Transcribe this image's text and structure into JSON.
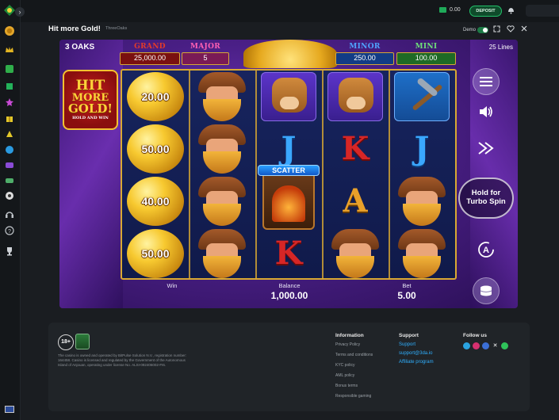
{
  "topbar": {
    "balance": "0.00",
    "deposit_label": "DEPOSIT"
  },
  "game_header": {
    "title": "Hit more Gold!",
    "provider": "ThreeOaks",
    "demo_label": "Demo"
  },
  "game": {
    "provider_badge": "3 OAKS",
    "lines": "25 Lines",
    "jackpots": [
      {
        "name": "GRAND",
        "value": "25,000.00",
        "color": "#e23a2a"
      },
      {
        "name": "MAJOR",
        "value": "5",
        "color": "#d94b9c"
      },
      {
        "name": "MINOR",
        "value": "250.00",
        "color": "#2f7de0"
      },
      {
        "name": "MINI",
        "value": "100.00",
        "color": "#3fb84a"
      }
    ],
    "logo": {
      "line1": "HIT",
      "line2": "MORE",
      "line3": "GOLD!",
      "line4": "HOLD AND WIN"
    },
    "gold_values": [
      "20.00",
      "50.00",
      "40.00",
      "50.00"
    ],
    "scatter_label": "SCATTER",
    "letters": {
      "j1": "J",
      "j2": "J",
      "k1": "K",
      "k2": "K",
      "a1": "A"
    },
    "stats": {
      "win_label": "Win",
      "balance_label": "Balance",
      "balance_value": "1,000.00",
      "bet_label": "Bet",
      "bet_value": "5.00"
    },
    "turbo_label_1": "Hold for",
    "turbo_label_2": "Turbo Spin",
    "auto_label": "A"
  },
  "footer": {
    "age_badge": "18+",
    "legal_text": "The casino is owned and operated by BitPulse Solution N.V., registration number: 164458. Casino is licensed and regulated by the Government of the Autonomous Island of Anjouan, operating under license No. ALSI-092406002-FI6.",
    "information": {
      "heading": "Information",
      "items": [
        "Privacy Policy",
        "Terms and conditions",
        "KYC policy",
        "AML policy",
        "Bonus terms",
        "Responsible gaming"
      ]
    },
    "support": {
      "heading": "Support",
      "items": [
        "Support",
        "support@3da.io",
        "Affiliate program"
      ]
    },
    "follow": {
      "heading": "Follow us",
      "icons": [
        "telegram-icon",
        "instagram-icon",
        "facebook-icon",
        "x-icon",
        "whatsapp-icon"
      ]
    }
  }
}
